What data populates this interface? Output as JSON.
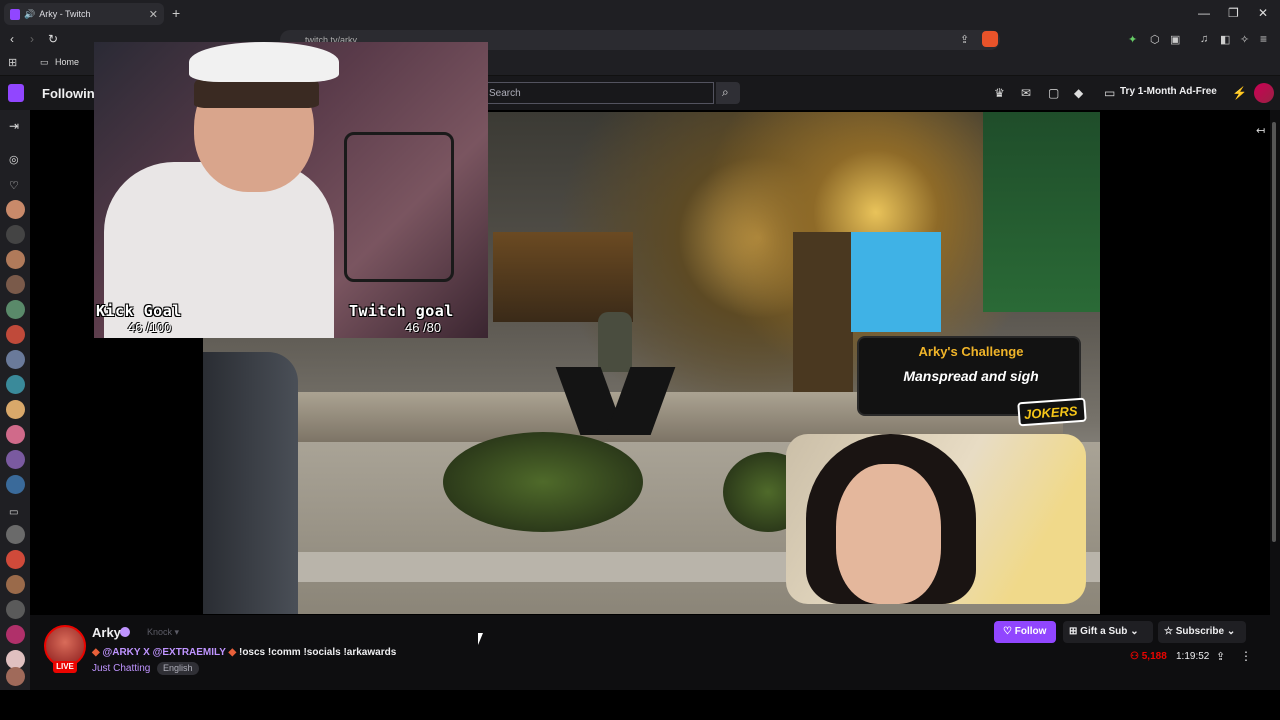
{
  "browser": {
    "tab_title": "Arky - Twitch",
    "url": "twitch.tv/arky",
    "bookmark_home": "Home"
  },
  "nav": {
    "following": "Following",
    "search_placeholder": "Search",
    "ad_free": "Try 1-Month Ad-Free"
  },
  "overlay": {
    "kick_goal_title": "Kick Goal",
    "kick_goal_value": "46 /100",
    "twitch_goal_title": "Twitch goal",
    "twitch_goal_value": "46 /80",
    "challenge_title": "Arky's Challenge",
    "challenge_text": "Manspread and sigh",
    "jokers_logo": "JOKERS"
  },
  "stream": {
    "name": "Arky",
    "knock": "Knock",
    "live_badge": "LIVE",
    "title_prefix": "@ARKY X @EXTRAEMILY",
    "title_suffix": "!oscs !comm !socials !arkawards",
    "category": "Just Chatting",
    "language": "English",
    "follow": "Follow",
    "gift": "Gift a Sub",
    "subscribe": "Subscribe",
    "viewers": "5,188",
    "uptime": "1:19:52"
  },
  "sidebar_avatar_colors": [
    "#c98a6a",
    "#444",
    "#b07a5a",
    "#7a5a4a",
    "#5a8a6a",
    "#c04a3a",
    "#6a7a9a",
    "#3a8a9a",
    "#d9a86a",
    "#d06a8a",
    "#7a5aa0",
    "#3a6a9a",
    "#6a6a6a",
    "#d04a3a",
    "#9a6a4a",
    "#5a5a5a",
    "#b0306a",
    "#e0c0c0",
    "#a06a5a"
  ]
}
